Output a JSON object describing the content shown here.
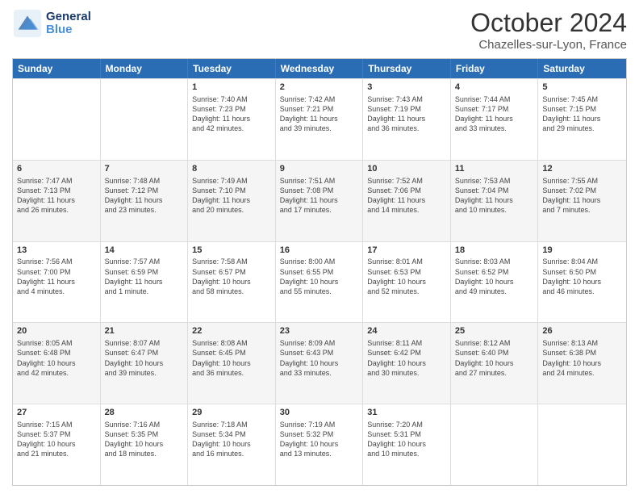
{
  "header": {
    "logo_general": "General",
    "logo_blue": "Blue",
    "title": "October 2024",
    "subtitle": "Chazelles-sur-Lyon, France"
  },
  "days": [
    "Sunday",
    "Monday",
    "Tuesday",
    "Wednesday",
    "Thursday",
    "Friday",
    "Saturday"
  ],
  "rows": [
    [
      {
        "day": "",
        "lines": []
      },
      {
        "day": "",
        "lines": []
      },
      {
        "day": "1",
        "lines": [
          "Sunrise: 7:40 AM",
          "Sunset: 7:23 PM",
          "Daylight: 11 hours",
          "and 42 minutes."
        ]
      },
      {
        "day": "2",
        "lines": [
          "Sunrise: 7:42 AM",
          "Sunset: 7:21 PM",
          "Daylight: 11 hours",
          "and 39 minutes."
        ]
      },
      {
        "day": "3",
        "lines": [
          "Sunrise: 7:43 AM",
          "Sunset: 7:19 PM",
          "Daylight: 11 hours",
          "and 36 minutes."
        ]
      },
      {
        "day": "4",
        "lines": [
          "Sunrise: 7:44 AM",
          "Sunset: 7:17 PM",
          "Daylight: 11 hours",
          "and 33 minutes."
        ]
      },
      {
        "day": "5",
        "lines": [
          "Sunrise: 7:45 AM",
          "Sunset: 7:15 PM",
          "Daylight: 11 hours",
          "and 29 minutes."
        ]
      }
    ],
    [
      {
        "day": "6",
        "lines": [
          "Sunrise: 7:47 AM",
          "Sunset: 7:13 PM",
          "Daylight: 11 hours",
          "and 26 minutes."
        ]
      },
      {
        "day": "7",
        "lines": [
          "Sunrise: 7:48 AM",
          "Sunset: 7:12 PM",
          "Daylight: 11 hours",
          "and 23 minutes."
        ]
      },
      {
        "day": "8",
        "lines": [
          "Sunrise: 7:49 AM",
          "Sunset: 7:10 PM",
          "Daylight: 11 hours",
          "and 20 minutes."
        ]
      },
      {
        "day": "9",
        "lines": [
          "Sunrise: 7:51 AM",
          "Sunset: 7:08 PM",
          "Daylight: 11 hours",
          "and 17 minutes."
        ]
      },
      {
        "day": "10",
        "lines": [
          "Sunrise: 7:52 AM",
          "Sunset: 7:06 PM",
          "Daylight: 11 hours",
          "and 14 minutes."
        ]
      },
      {
        "day": "11",
        "lines": [
          "Sunrise: 7:53 AM",
          "Sunset: 7:04 PM",
          "Daylight: 11 hours",
          "and 10 minutes."
        ]
      },
      {
        "day": "12",
        "lines": [
          "Sunrise: 7:55 AM",
          "Sunset: 7:02 PM",
          "Daylight: 11 hours",
          "and 7 minutes."
        ]
      }
    ],
    [
      {
        "day": "13",
        "lines": [
          "Sunrise: 7:56 AM",
          "Sunset: 7:00 PM",
          "Daylight: 11 hours",
          "and 4 minutes."
        ]
      },
      {
        "day": "14",
        "lines": [
          "Sunrise: 7:57 AM",
          "Sunset: 6:59 PM",
          "Daylight: 11 hours",
          "and 1 minute."
        ]
      },
      {
        "day": "15",
        "lines": [
          "Sunrise: 7:58 AM",
          "Sunset: 6:57 PM",
          "Daylight: 10 hours",
          "and 58 minutes."
        ]
      },
      {
        "day": "16",
        "lines": [
          "Sunrise: 8:00 AM",
          "Sunset: 6:55 PM",
          "Daylight: 10 hours",
          "and 55 minutes."
        ]
      },
      {
        "day": "17",
        "lines": [
          "Sunrise: 8:01 AM",
          "Sunset: 6:53 PM",
          "Daylight: 10 hours",
          "and 52 minutes."
        ]
      },
      {
        "day": "18",
        "lines": [
          "Sunrise: 8:03 AM",
          "Sunset: 6:52 PM",
          "Daylight: 10 hours",
          "and 49 minutes."
        ]
      },
      {
        "day": "19",
        "lines": [
          "Sunrise: 8:04 AM",
          "Sunset: 6:50 PM",
          "Daylight: 10 hours",
          "and 46 minutes."
        ]
      }
    ],
    [
      {
        "day": "20",
        "lines": [
          "Sunrise: 8:05 AM",
          "Sunset: 6:48 PM",
          "Daylight: 10 hours",
          "and 42 minutes."
        ]
      },
      {
        "day": "21",
        "lines": [
          "Sunrise: 8:07 AM",
          "Sunset: 6:47 PM",
          "Daylight: 10 hours",
          "and 39 minutes."
        ]
      },
      {
        "day": "22",
        "lines": [
          "Sunrise: 8:08 AM",
          "Sunset: 6:45 PM",
          "Daylight: 10 hours",
          "and 36 minutes."
        ]
      },
      {
        "day": "23",
        "lines": [
          "Sunrise: 8:09 AM",
          "Sunset: 6:43 PM",
          "Daylight: 10 hours",
          "and 33 minutes."
        ]
      },
      {
        "day": "24",
        "lines": [
          "Sunrise: 8:11 AM",
          "Sunset: 6:42 PM",
          "Daylight: 10 hours",
          "and 30 minutes."
        ]
      },
      {
        "day": "25",
        "lines": [
          "Sunrise: 8:12 AM",
          "Sunset: 6:40 PM",
          "Daylight: 10 hours",
          "and 27 minutes."
        ]
      },
      {
        "day": "26",
        "lines": [
          "Sunrise: 8:13 AM",
          "Sunset: 6:38 PM",
          "Daylight: 10 hours",
          "and 24 minutes."
        ]
      }
    ],
    [
      {
        "day": "27",
        "lines": [
          "Sunrise: 7:15 AM",
          "Sunset: 5:37 PM",
          "Daylight: 10 hours",
          "and 21 minutes."
        ]
      },
      {
        "day": "28",
        "lines": [
          "Sunrise: 7:16 AM",
          "Sunset: 5:35 PM",
          "Daylight: 10 hours",
          "and 18 minutes."
        ]
      },
      {
        "day": "29",
        "lines": [
          "Sunrise: 7:18 AM",
          "Sunset: 5:34 PM",
          "Daylight: 10 hours",
          "and 16 minutes."
        ]
      },
      {
        "day": "30",
        "lines": [
          "Sunrise: 7:19 AM",
          "Sunset: 5:32 PM",
          "Daylight: 10 hours",
          "and 13 minutes."
        ]
      },
      {
        "day": "31",
        "lines": [
          "Sunrise: 7:20 AM",
          "Sunset: 5:31 PM",
          "Daylight: 10 hours",
          "and 10 minutes."
        ]
      },
      {
        "day": "",
        "lines": []
      },
      {
        "day": "",
        "lines": []
      }
    ]
  ]
}
